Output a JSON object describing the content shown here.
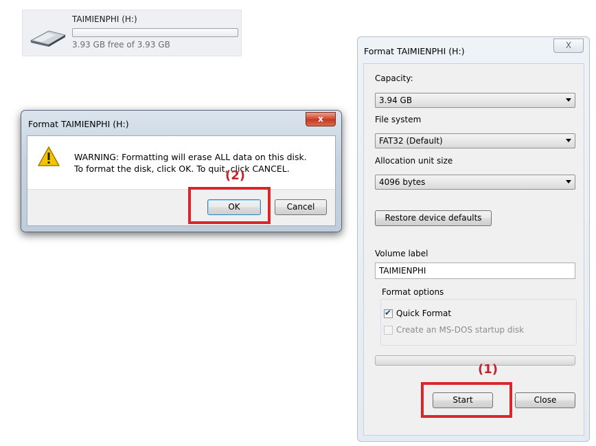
{
  "drive": {
    "name": "TAIMIENPHI (H:)",
    "free_text": "3.93 GB free of 3.93 GB",
    "used_fraction": 0.0
  },
  "warning_dialog": {
    "title": "Format TAIMIENPHI (H:)",
    "close_label": "x",
    "message_line1": "WARNING: Formatting will erase ALL data on this disk.",
    "message_line2": "To format the disk, click OK. To quit, click CANCEL.",
    "ok_label": "OK",
    "cancel_label": "Cancel"
  },
  "format_dialog": {
    "title": "Format TAIMIENPHI (H:)",
    "close_label": "X",
    "capacity_label": "Capacity:",
    "capacity_value": "3.94 GB",
    "filesystem_label": "File system",
    "filesystem_value": "FAT32 (Default)",
    "allocation_label": "Allocation unit size",
    "allocation_value": "4096 bytes",
    "restore_label": "Restore device defaults",
    "volume_label_label": "Volume label",
    "volume_label_value": "TAIMIENPHI",
    "format_options_label": "Format options",
    "quick_format_label": "Quick Format",
    "quick_format_checked": true,
    "msdos_label": "Create an MS-DOS startup disk",
    "msdos_checked": false,
    "progress_fraction": 0.0,
    "start_label": "Start",
    "close_button_label": "Close"
  },
  "annotations": {
    "step1": "(1)",
    "step2": "(2)",
    "highlight_color": "#d9262c"
  }
}
